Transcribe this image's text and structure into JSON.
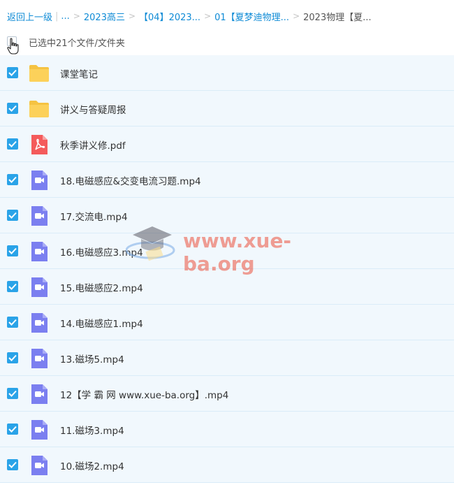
{
  "breadcrumb": {
    "back_label": "返回上一级",
    "ellipsis": "...",
    "items": [
      "2023高三",
      "【04】2023...",
      "01【夏梦迪物理...",
      "2023物理【夏..."
    ]
  },
  "selection": {
    "label": "已选中21个文件/文件夹"
  },
  "files": [
    {
      "name": "课堂笔记",
      "icon": "folder-icon"
    },
    {
      "name": "讲义与答疑周报",
      "icon": "folder-icon"
    },
    {
      "name": "秋季讲义修.pdf",
      "icon": "pdf-icon"
    },
    {
      "name": "18.电磁感应&交变电流习题.mp4",
      "icon": "video-icon"
    },
    {
      "name": "17.交流电.mp4",
      "icon": "video-icon"
    },
    {
      "name": "16.电磁感应3.mp4",
      "icon": "video-icon"
    },
    {
      "name": "15.电磁感应2.mp4",
      "icon": "video-icon"
    },
    {
      "name": "14.电磁感应1.mp4",
      "icon": "video-icon"
    },
    {
      "name": "13.磁场5.mp4",
      "icon": "video-icon"
    },
    {
      "name": "12【学 霸 网 www.xue-ba.org】.mp4",
      "icon": "video-icon"
    },
    {
      "name": "11.磁场3.mp4",
      "icon": "video-icon"
    },
    {
      "name": "10.磁场2.mp4",
      "icon": "video-icon"
    }
  ],
  "watermark": {
    "text": "www.xue-ba.org"
  },
  "colors": {
    "link": "#0f8bd6",
    "checkbox": "#2aa3e8",
    "row_bg": "#f1f8fd",
    "folder": "#fcd15a",
    "pdf": "#f45b5b",
    "video": "#7b7ff0"
  }
}
